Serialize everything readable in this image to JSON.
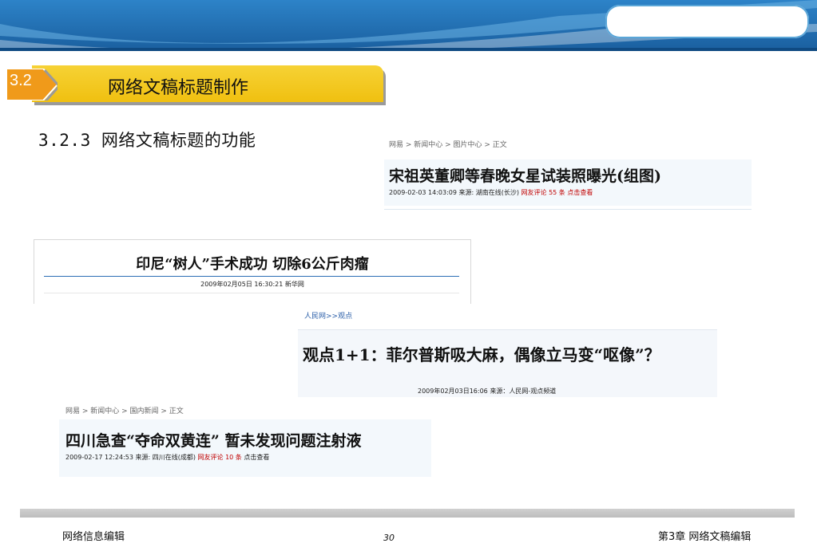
{
  "section": {
    "number": "3.2",
    "title": "网络文稿标题制作"
  },
  "subheading": "3.2.3 网络文稿标题的功能",
  "articles": [
    {
      "breadcrumb": "网易 > 新闻中心 > 图片中心 > 正文",
      "title": "宋祖英董卿等春晚女星试装照曝光(组图)",
      "meta": "2009-02-03 14:03:09  来源: 湖南在线(长沙)",
      "comment_link": "网友评论 55 条 点击查看"
    },
    {
      "title": "印尼“树人”手术成功  切除6公斤肉瘤",
      "meta": "2009年02月05日 16:30:21    新华网"
    },
    {
      "breadcrumb": "人民网>>观点",
      "title": "观点1+1：菲尔普斯吸大麻，偶像立马变“呕像”？",
      "meta": "2009年02月03日16:06  来源：人民网-观点频道"
    },
    {
      "breadcrumb": "网易 > 新闻中心 > 国内新闻 > 正文",
      "title": "四川急查“夺命双黄连”  暂未发现问题注射液",
      "meta": "2009-02-17 12:24:53  来源: 四川在线(成都)",
      "comment_link": "网友评论 10 条",
      "view_link": "点击查看"
    }
  ],
  "footer": {
    "left": "网络信息编辑",
    "page": "30",
    "right": "第3章 网络文稿编辑"
  },
  "colors": {
    "banner": "#1f6cb0",
    "section_bar": "#f2c418",
    "badge": "#f09a1a"
  }
}
